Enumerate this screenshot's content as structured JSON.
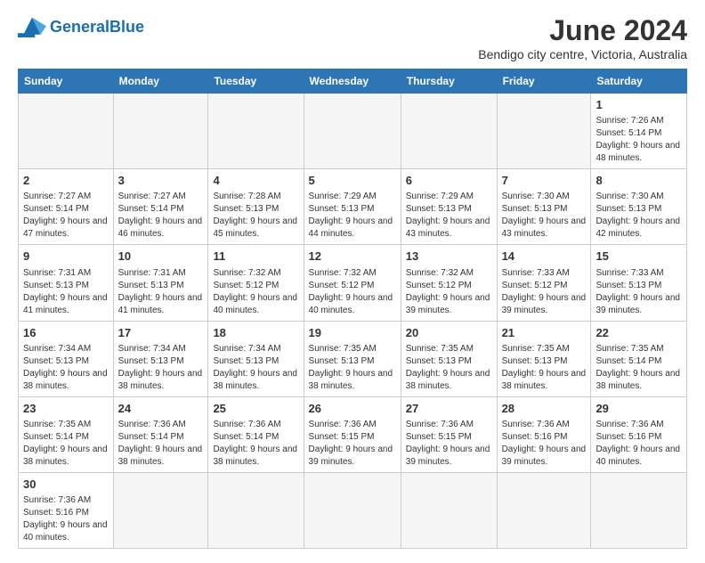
{
  "header": {
    "logo_general": "General",
    "logo_blue": "Blue",
    "month_title": "June 2024",
    "subtitle": "Bendigo city centre, Victoria, Australia"
  },
  "days_of_week": [
    "Sunday",
    "Monday",
    "Tuesday",
    "Wednesday",
    "Thursday",
    "Friday",
    "Saturday"
  ],
  "weeks": [
    {
      "days": [
        {
          "num": "",
          "info": "",
          "empty": true
        },
        {
          "num": "",
          "info": "",
          "empty": true
        },
        {
          "num": "",
          "info": "",
          "empty": true
        },
        {
          "num": "",
          "info": "",
          "empty": true
        },
        {
          "num": "",
          "info": "",
          "empty": true
        },
        {
          "num": "",
          "info": "",
          "empty": true
        },
        {
          "num": "1",
          "info": "Sunrise: 7:26 AM\nSunset: 5:14 PM\nDaylight: 9 hours\nand 48 minutes."
        }
      ]
    },
    {
      "days": [
        {
          "num": "2",
          "info": "Sunrise: 7:27 AM\nSunset: 5:14 PM\nDaylight: 9 hours\nand 47 minutes."
        },
        {
          "num": "3",
          "info": "Sunrise: 7:27 AM\nSunset: 5:14 PM\nDaylight: 9 hours\nand 46 minutes."
        },
        {
          "num": "4",
          "info": "Sunrise: 7:28 AM\nSunset: 5:13 PM\nDaylight: 9 hours\nand 45 minutes."
        },
        {
          "num": "5",
          "info": "Sunrise: 7:29 AM\nSunset: 5:13 PM\nDaylight: 9 hours\nand 44 minutes."
        },
        {
          "num": "6",
          "info": "Sunrise: 7:29 AM\nSunset: 5:13 PM\nDaylight: 9 hours\nand 43 minutes."
        },
        {
          "num": "7",
          "info": "Sunrise: 7:30 AM\nSunset: 5:13 PM\nDaylight: 9 hours\nand 43 minutes."
        },
        {
          "num": "8",
          "info": "Sunrise: 7:30 AM\nSunset: 5:13 PM\nDaylight: 9 hours\nand 42 minutes."
        }
      ]
    },
    {
      "days": [
        {
          "num": "9",
          "info": "Sunrise: 7:31 AM\nSunset: 5:13 PM\nDaylight: 9 hours\nand 41 minutes."
        },
        {
          "num": "10",
          "info": "Sunrise: 7:31 AM\nSunset: 5:13 PM\nDaylight: 9 hours\nand 41 minutes."
        },
        {
          "num": "11",
          "info": "Sunrise: 7:32 AM\nSunset: 5:12 PM\nDaylight: 9 hours\nand 40 minutes."
        },
        {
          "num": "12",
          "info": "Sunrise: 7:32 AM\nSunset: 5:12 PM\nDaylight: 9 hours\nand 40 minutes."
        },
        {
          "num": "13",
          "info": "Sunrise: 7:32 AM\nSunset: 5:12 PM\nDaylight: 9 hours\nand 39 minutes."
        },
        {
          "num": "14",
          "info": "Sunrise: 7:33 AM\nSunset: 5:12 PM\nDaylight: 9 hours\nand 39 minutes."
        },
        {
          "num": "15",
          "info": "Sunrise: 7:33 AM\nSunset: 5:13 PM\nDaylight: 9 hours\nand 39 minutes."
        }
      ]
    },
    {
      "days": [
        {
          "num": "16",
          "info": "Sunrise: 7:34 AM\nSunset: 5:13 PM\nDaylight: 9 hours\nand 38 minutes."
        },
        {
          "num": "17",
          "info": "Sunrise: 7:34 AM\nSunset: 5:13 PM\nDaylight: 9 hours\nand 38 minutes."
        },
        {
          "num": "18",
          "info": "Sunrise: 7:34 AM\nSunset: 5:13 PM\nDaylight: 9 hours\nand 38 minutes."
        },
        {
          "num": "19",
          "info": "Sunrise: 7:35 AM\nSunset: 5:13 PM\nDaylight: 9 hours\nand 38 minutes."
        },
        {
          "num": "20",
          "info": "Sunrise: 7:35 AM\nSunset: 5:13 PM\nDaylight: 9 hours\nand 38 minutes."
        },
        {
          "num": "21",
          "info": "Sunrise: 7:35 AM\nSunset: 5:13 PM\nDaylight: 9 hours\nand 38 minutes."
        },
        {
          "num": "22",
          "info": "Sunrise: 7:35 AM\nSunset: 5:14 PM\nDaylight: 9 hours\nand 38 minutes."
        }
      ]
    },
    {
      "days": [
        {
          "num": "23",
          "info": "Sunrise: 7:35 AM\nSunset: 5:14 PM\nDaylight: 9 hours\nand 38 minutes."
        },
        {
          "num": "24",
          "info": "Sunrise: 7:36 AM\nSunset: 5:14 PM\nDaylight: 9 hours\nand 38 minutes."
        },
        {
          "num": "25",
          "info": "Sunrise: 7:36 AM\nSunset: 5:14 PM\nDaylight: 9 hours\nand 38 minutes."
        },
        {
          "num": "26",
          "info": "Sunrise: 7:36 AM\nSunset: 5:15 PM\nDaylight: 9 hours\nand 39 minutes."
        },
        {
          "num": "27",
          "info": "Sunrise: 7:36 AM\nSunset: 5:15 PM\nDaylight: 9 hours\nand 39 minutes."
        },
        {
          "num": "28",
          "info": "Sunrise: 7:36 AM\nSunset: 5:16 PM\nDaylight: 9 hours\nand 39 minutes."
        },
        {
          "num": "29",
          "info": "Sunrise: 7:36 AM\nSunset: 5:16 PM\nDaylight: 9 hours\nand 40 minutes."
        }
      ]
    },
    {
      "days": [
        {
          "num": "30",
          "info": "Sunrise: 7:36 AM\nSunset: 5:16 PM\nDaylight: 9 hours\nand 40 minutes."
        },
        {
          "num": "",
          "info": "",
          "empty": true
        },
        {
          "num": "",
          "info": "",
          "empty": true
        },
        {
          "num": "",
          "info": "",
          "empty": true
        },
        {
          "num": "",
          "info": "",
          "empty": true
        },
        {
          "num": "",
          "info": "",
          "empty": true
        },
        {
          "num": "",
          "info": "",
          "empty": true
        }
      ]
    }
  ]
}
